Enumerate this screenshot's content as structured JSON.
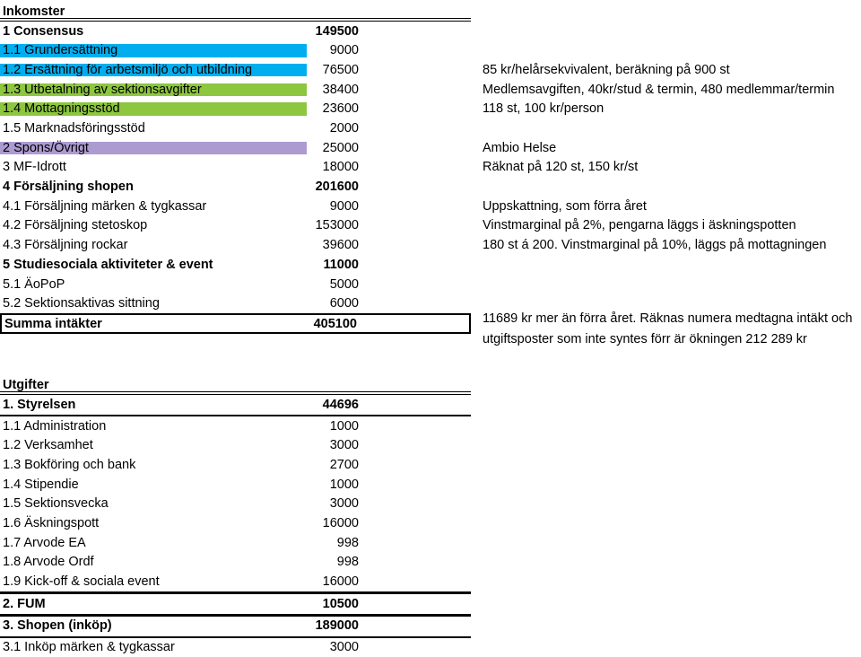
{
  "income": {
    "title": "Inkomster",
    "rows": [
      {
        "label": "1 Consensus",
        "value": "149500",
        "bold": true,
        "highlight": "none",
        "note": ""
      },
      {
        "label": "1.1 Grundersättning",
        "value": "9000",
        "bold": false,
        "highlight": "blue",
        "note": ""
      },
      {
        "label": "1.2 Ersättning för arbetsmiljö och utbildning",
        "value": "76500",
        "bold": false,
        "highlight": "blue",
        "note": "85 kr/helårsekvivalent, beräkning på 900 st"
      },
      {
        "label": "1.3 Utbetalning av sektionsavgifter",
        "value": "38400",
        "bold": false,
        "highlight": "green",
        "note": "Medlemsavgiften, 40kr/stud & termin, 480 medlemmar/termin"
      },
      {
        "label": "1.4 Mottagningsstöd",
        "value": "23600",
        "bold": false,
        "highlight": "green",
        "note": "118 st, 100 kr/person"
      },
      {
        "label": "1.5 Marknadsföringsstöd",
        "value": "2000",
        "bold": false,
        "highlight": "none",
        "note": ""
      },
      {
        "label": "2 Spons/Övrigt",
        "value": "25000",
        "bold": false,
        "highlight": "purple",
        "note": "Ambio Helse"
      },
      {
        "label": "3 MF-Idrott",
        "value": "18000",
        "bold": false,
        "highlight": "none",
        "note": "Räknat på 120 st, 150 kr/st"
      },
      {
        "label": "4 Försäljning shopen",
        "value": "201600",
        "bold": true,
        "highlight": "none",
        "note": ""
      },
      {
        "label": "4.1 Försäljning märken & tygkassar",
        "value": "9000",
        "bold": false,
        "highlight": "none",
        "note": "Uppskattning, som förra året"
      },
      {
        "label": "4.2 Försäljning stetoskop",
        "value": "153000",
        "bold": false,
        "highlight": "none",
        "note": "Vinstmarginal på 2%, pengarna läggs i äskningspotten"
      },
      {
        "label": "4.3 Försäljning rockar",
        "value": "39600",
        "bold": false,
        "highlight": "none",
        "note": "180 st á 200. Vinstmarginal på 10%, läggs på mottagningen"
      },
      {
        "label": "5 Studiesociala aktiviteter & event",
        "value": "11000",
        "bold": true,
        "highlight": "none",
        "note": ""
      },
      {
        "label": "5.1 ÄoPoP",
        "value": "5000",
        "bold": false,
        "highlight": "none",
        "note": ""
      },
      {
        "label": "5.2 Sektionsaktivas sittning",
        "value": "6000",
        "bold": false,
        "highlight": "none",
        "note": ""
      }
    ],
    "total": {
      "label": "Summa intäkter",
      "value": "405100"
    },
    "total_note_line1": "11689 kr mer än förra året. Räknas numera medtagna intäkt och",
    "total_note_line2": "utgiftsposter som inte syntes förr är ökningen 212 289 kr"
  },
  "expenses": {
    "title": "Utgifter",
    "rows": [
      {
        "label": "1. Styrelsen",
        "value": "44696",
        "bold": true,
        "rule_above": "double",
        "rule_below": "thick"
      },
      {
        "label": "1.1 Administration",
        "value": "1000",
        "bold": false,
        "rule_above": "none",
        "rule_below": "none"
      },
      {
        "label": "1.2 Verksamhet",
        "value": "3000",
        "bold": false,
        "rule_above": "none",
        "rule_below": "none"
      },
      {
        "label": "1.3 Bokföring och bank",
        "value": "2700",
        "bold": false,
        "rule_above": "none",
        "rule_below": "none"
      },
      {
        "label": "1.4 Stipendie",
        "value": "1000",
        "bold": false,
        "rule_above": "none",
        "rule_below": "none"
      },
      {
        "label": "1.5 Sektionsvecka",
        "value": "3000",
        "bold": false,
        "rule_above": "none",
        "rule_below": "none"
      },
      {
        "label": "1.6 Äskningspott",
        "value": "16000",
        "bold": false,
        "rule_above": "none",
        "rule_below": "none"
      },
      {
        "label": "1.7 Arvode EA",
        "value": "998",
        "bold": false,
        "rule_above": "none",
        "rule_below": "none"
      },
      {
        "label": "1.8 Arvode Ordf",
        "value": "998",
        "bold": false,
        "rule_above": "none",
        "rule_below": "none"
      },
      {
        "label": "1.9 Kick-off & sociala event",
        "value": "16000",
        "bold": false,
        "rule_above": "none",
        "rule_below": "thin"
      },
      {
        "label": "2. FUM",
        "value": "10500",
        "bold": true,
        "rule_above": "thick",
        "rule_below": "thick"
      },
      {
        "label": "3. Shopen (inköp)",
        "value": "189000",
        "bold": true,
        "rule_above": "thin",
        "rule_below": "thick"
      },
      {
        "label": "3.1 Inköp märken & tygkassar",
        "value": "3000",
        "bold": false,
        "rule_above": "none",
        "rule_below": "none"
      }
    ]
  }
}
